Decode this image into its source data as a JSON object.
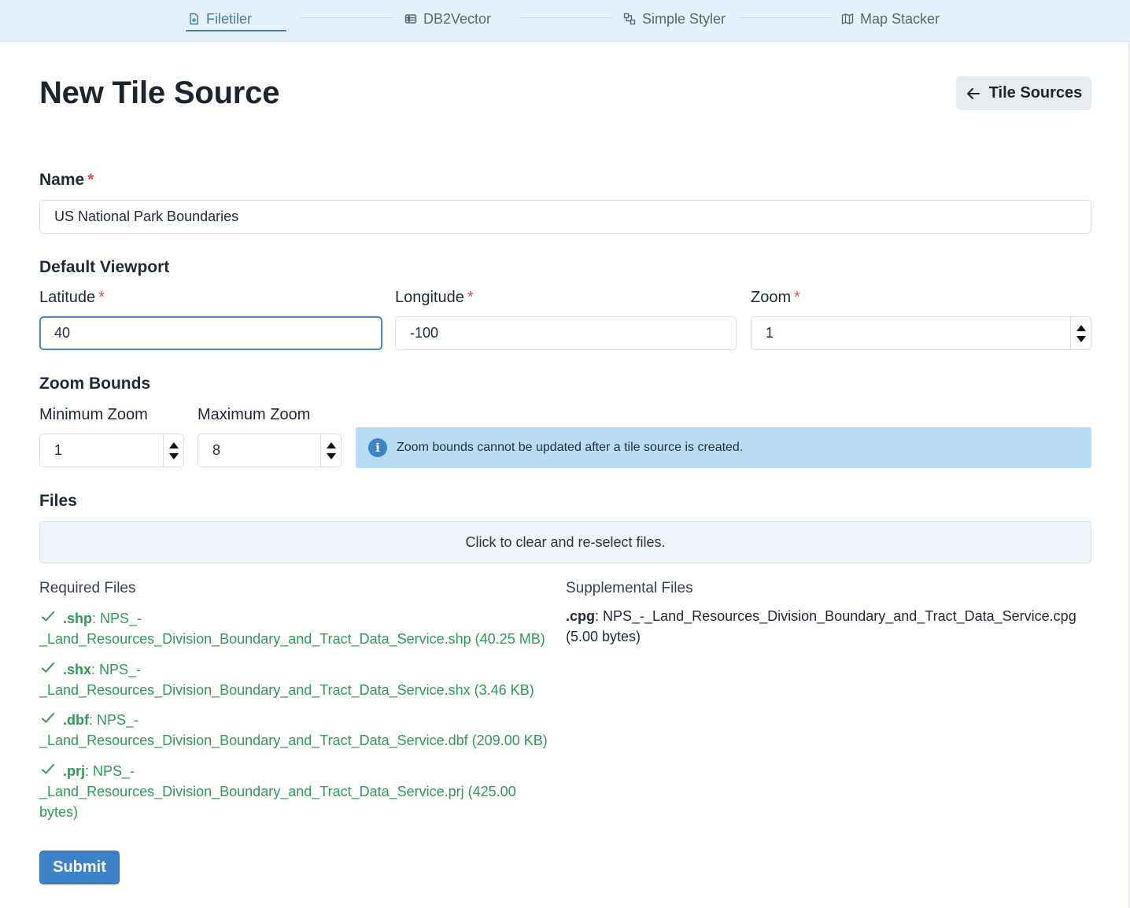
{
  "nav": {
    "tabs": [
      {
        "label": "Filetiler",
        "icon": "file-plus-icon",
        "active": true
      },
      {
        "label": "DB2Vector",
        "icon": "database-icon",
        "active": false
      },
      {
        "label": "Simple Styler",
        "icon": "style-nodes-icon",
        "active": false
      },
      {
        "label": "Map Stacker",
        "icon": "map-icon",
        "active": false
      }
    ]
  },
  "page": {
    "title": "New Tile Source",
    "back_button": "Tile Sources"
  },
  "form": {
    "name": {
      "label": "Name",
      "required_mark": "*",
      "value": "US National Park Boundaries"
    },
    "default_viewport": {
      "heading": "Default Viewport",
      "latitude": {
        "label": "Latitude",
        "required_mark": "*",
        "value": "40"
      },
      "longitude": {
        "label": "Longitude",
        "required_mark": "*",
        "value": "-100"
      },
      "zoom": {
        "label": "Zoom",
        "required_mark": "*",
        "value": "1"
      }
    },
    "zoom_bounds": {
      "heading": "Zoom Bounds",
      "min": {
        "label": "Minimum Zoom",
        "value": "1"
      },
      "max": {
        "label": "Maximum Zoom",
        "value": "8"
      },
      "notice": "Zoom bounds cannot be updated after a tile source is created."
    },
    "files": {
      "heading": "Files",
      "dropzone": "Click to clear and re-select files.",
      "required_title": "Required Files",
      "supplemental_title": "Supplemental Files",
      "required": [
        {
          "ext": ".shp",
          "line1": ": NPS_-",
          "line2": "_Land_Resources_Division_Boundary_and_Tract_Data_Service.shp (40.25 MB)",
          "line3": ""
        },
        {
          "ext": ".shx",
          "line1": ": NPS_-",
          "line2": "_Land_Resources_Division_Boundary_and_Tract_Data_Service.shx (3.46 KB)",
          "line3": ""
        },
        {
          "ext": ".dbf",
          "line1": ": NPS_-",
          "line2": "_Land_Resources_Division_Boundary_and_Tract_Data_Service.dbf (209.00 KB)",
          "line3": ""
        },
        {
          "ext": ".prj",
          "line1": ": NPS_-",
          "line2": "_Land_Resources_Division_Boundary_and_Tract_Data_Service.prj (425.00",
          "line3": "bytes)"
        }
      ],
      "supplemental": [
        {
          "ext": ".cpg",
          "text": ": NPS_-_Land_Resources_Division_Boundary_and_Tract_Data_Service.cpg",
          "size": "(5.00 bytes)"
        }
      ]
    },
    "submit": "Submit"
  },
  "colors": {
    "accent": "#3b82c9",
    "success": "#2f9a55",
    "required": "#e05252",
    "info_bg": "#b8dcf5"
  }
}
